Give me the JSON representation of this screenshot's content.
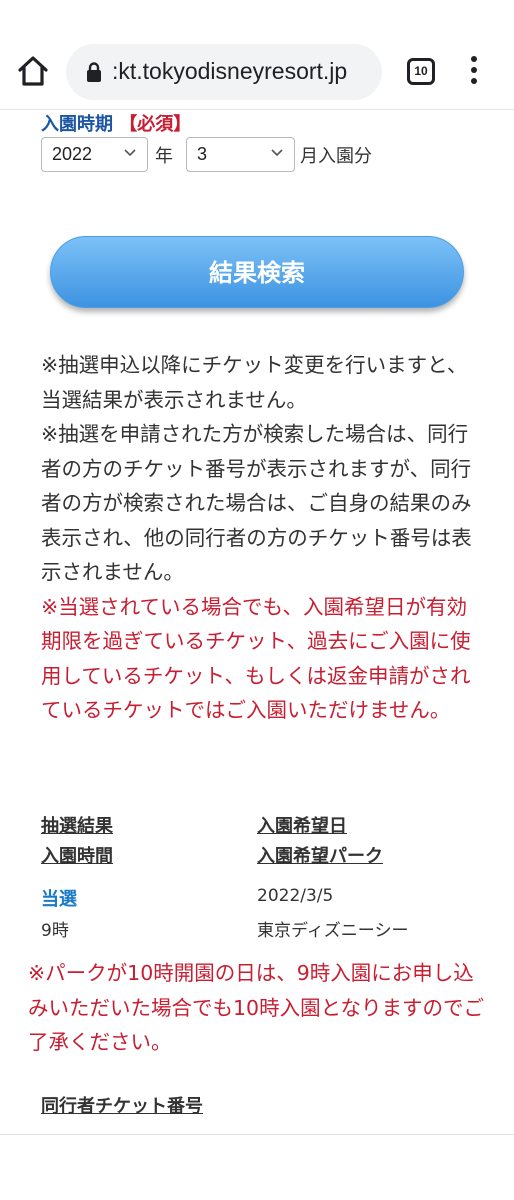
{
  "browser": {
    "url": ":kt.tokyodisneyresort.jp",
    "tab_count": "10",
    "icons": [
      "home-icon",
      "lock-icon",
      "tabs-icon",
      "more-menu-icon"
    ]
  },
  "form": {
    "period_label": "入園時期",
    "required_label": "【必須】",
    "year_value": "2022",
    "year_unit": "年",
    "month_value": "3",
    "month_unit": "月入園分",
    "search_button": "結果検索"
  },
  "notes": {
    "line1": "※抽選申込以降にチケット変更を行いますと、当選結果が表示されません。",
    "line2": "※抽選を申請された方が検索した場合は、同行者の方のチケット番号が表示されますが、同行者の方が検索された場合は、ご自身の結果のみ表示され、他の同行者の方のチケット番号は表示されません。",
    "warning": "※当選されている場合でも、入園希望日が有効期限を過ぎているチケット、過去にご入園に使用しているチケット、もしくは返金申請がされているチケットではご入園いただけません。"
  },
  "results": {
    "header_result": "抽選結果",
    "header_time": "入園時間",
    "header_date": "入園希望日",
    "header_park": "入園希望パーク",
    "result": "当選",
    "time": "9時",
    "date": "2022/3/5",
    "park": "東京ディズニーシー"
  },
  "park_note": "※パークが10時開園の日は、9時入園にお申し込みいただいた場合でも10時入園となりますのでご了承ください。",
  "companion_label": "同行者チケット番号",
  "colors": {
    "label_blue": "#1c56a3",
    "required_red": "#c81e32",
    "win_blue": "#1c7bc8",
    "button_gradient_top": "#7cc1f6",
    "button_gradient_bottom": "#3d93e2"
  }
}
